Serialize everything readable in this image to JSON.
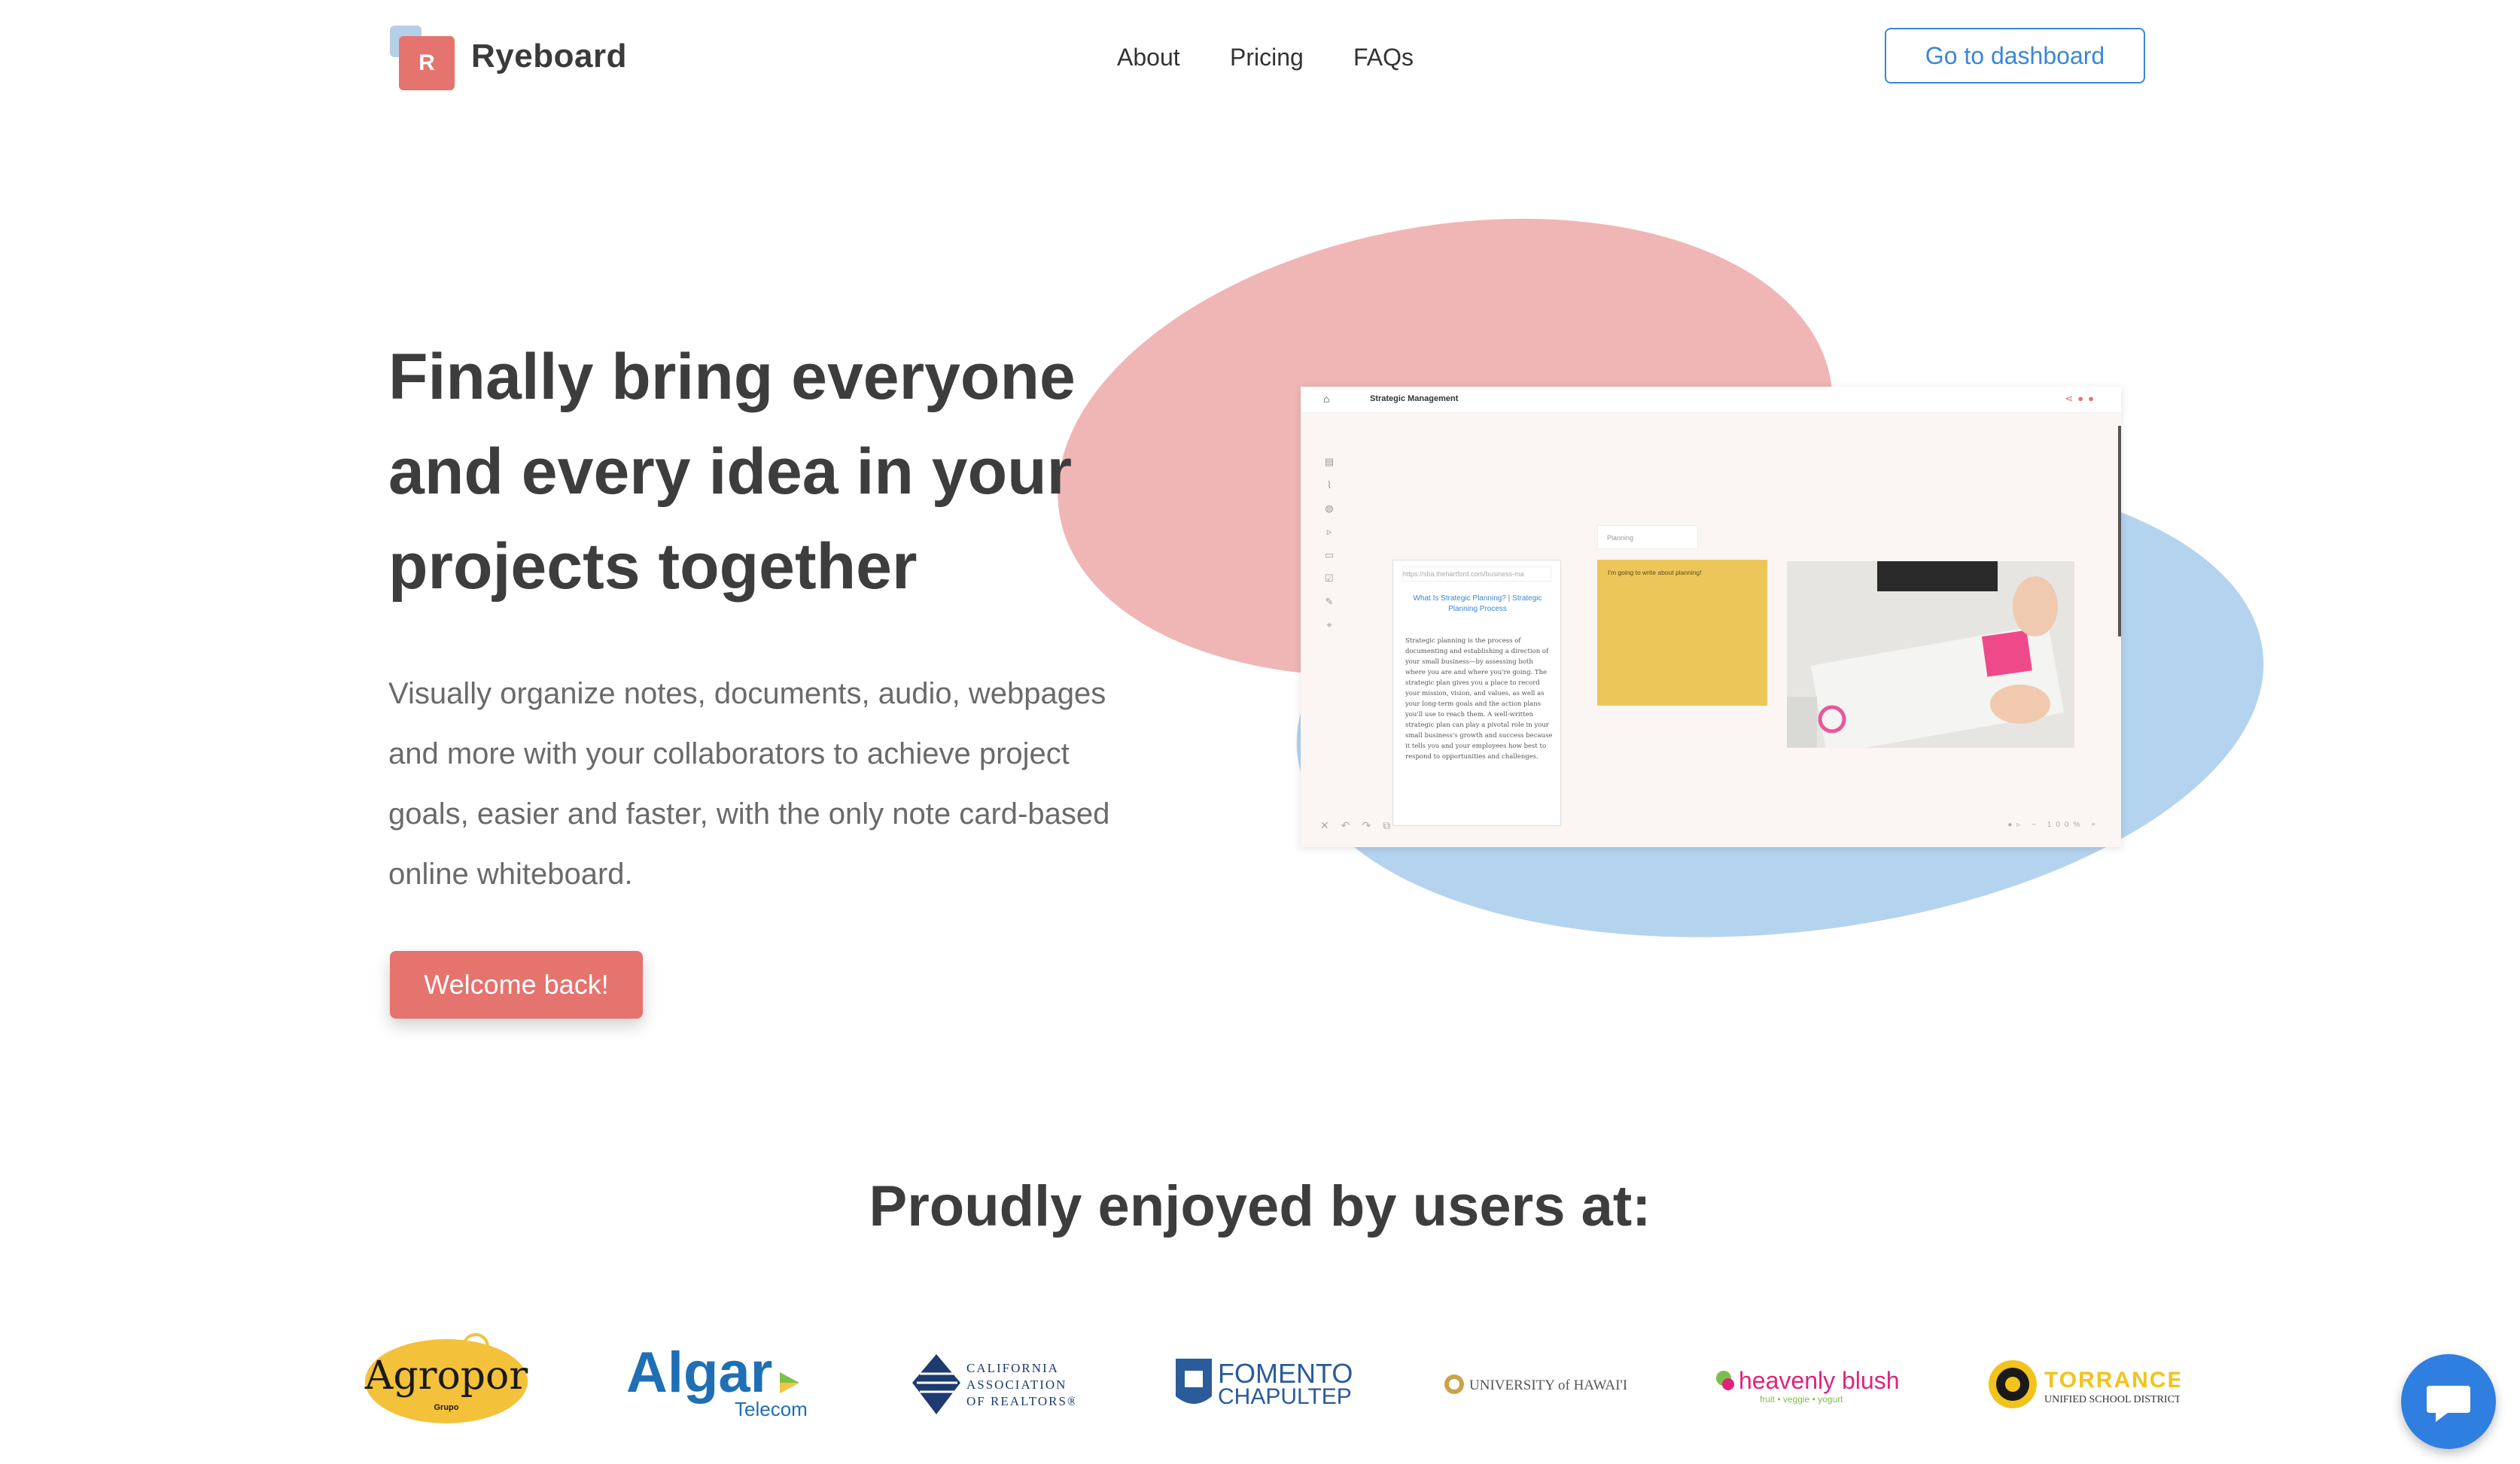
{
  "header": {
    "logo_letter": "R",
    "brand": "Ryeboard",
    "nav": [
      "About",
      "Pricing",
      "FAQs"
    ],
    "dashboard_button": "Go to dashboard"
  },
  "hero": {
    "headline": "Finally bring everyone and every idea in your projects together",
    "subtext": "Visually organize notes, documents, audio, webpages and more with your collaborators to achieve project goals, easier and faster, with the only note card-based online whiteboard.",
    "cta": "Welcome back!"
  },
  "app_preview": {
    "board_title": "Strategic Management",
    "web_url": "https://sba.thehartford.com/business-ma",
    "web_heading": "What Is Strategic Planning? | Strategic Planning Process",
    "web_body": "Strategic planning is the process of documenting and establishing a direction of your small business—by assessing both where you are and where you're going. The strategic plan gives you a place to record your mission, vision, and values, as well as your long-term goals and the action plans you'll use to reach them. A well-written strategic plan can play a pivotal role in your small business's growth and success because it tells you and your employees how best to respond to opportunities and challenges.",
    "note_label": "Planning",
    "note_text": "I'm going to write about planning!",
    "zoom": "100%"
  },
  "logos_section": {
    "title": "Proudly enjoyed by users at:",
    "logos": [
      {
        "name": "Agropor",
        "sub": "Grupo",
        "color": "#f3c23a"
      },
      {
        "name": "Algar",
        "sub": "Telecom",
        "color": "#1f6fb5"
      },
      {
        "name": "California Association of Realtors",
        "lines": [
          "CALIFORNIA",
          "ASSOCIATION",
          "OF REALTORS®"
        ],
        "color": "#1d3b6e"
      },
      {
        "name": "Fomento Chapultepec",
        "lines": [
          "FOMENTO",
          "CHAPULTEPEC"
        ],
        "color": "#2a5b9a"
      },
      {
        "name": "University of Hawaii",
        "text": "UNIVERSITY of HAWAI'I",
        "color": "#555555"
      },
      {
        "name": "heavenly blush",
        "text": "heavenly blush",
        "sub": "fruit • veggie • yogurt",
        "color": "#e2227c"
      },
      {
        "name": "Torrance Unified School District",
        "text": "TORRANCE",
        "sub": "UNIFIED SCHOOL DISTRICT",
        "color": "#f2c31c"
      }
    ]
  }
}
